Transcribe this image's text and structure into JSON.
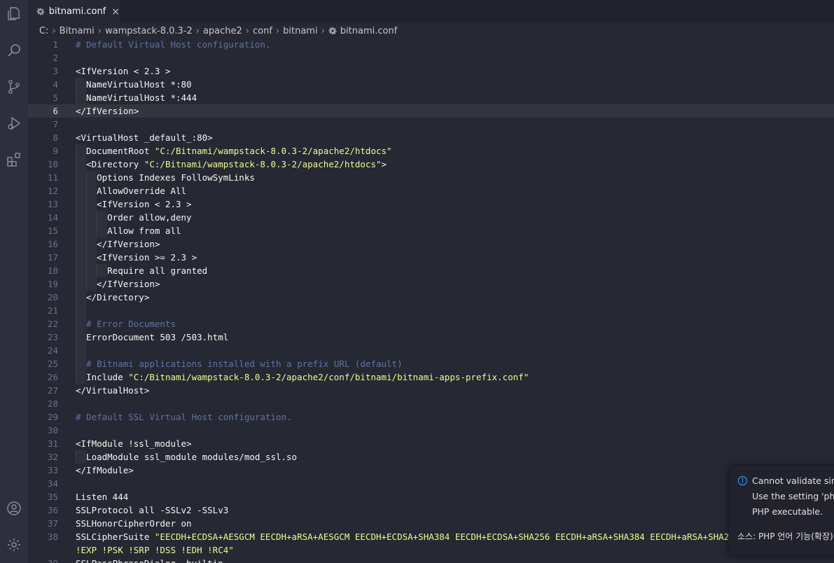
{
  "activity_bar": {
    "items": [
      {
        "icon": "explorer-icon"
      },
      {
        "icon": "search-icon"
      },
      {
        "icon": "source-control-icon"
      },
      {
        "icon": "run-debug-icon"
      },
      {
        "icon": "extensions-icon"
      }
    ],
    "bottom": [
      {
        "icon": "account-icon"
      },
      {
        "icon": "manage-gear-icon"
      }
    ]
  },
  "tab": {
    "label": "bitnami.conf",
    "close": "×",
    "icon": "settings-file-icon"
  },
  "breadcrumb": [
    "C:",
    "Bitnami",
    "wampstack-8.0.3-2",
    "apache2",
    "conf",
    "bitnami",
    "bitnami.conf"
  ],
  "editor": {
    "current_line": 6,
    "lines": [
      [
        [
          "c",
          "# Default Virtual Host configuration."
        ]
      ],
      [],
      [
        [
          "t",
          "<IfVersion < 2.3 >"
        ]
      ],
      [
        [
          "t",
          "  NameVirtualHost *:80"
        ]
      ],
      [
        [
          "t",
          "  NameVirtualHost *:444"
        ]
      ],
      [
        [
          "t",
          "</IfVersion>"
        ]
      ],
      [],
      [
        [
          "t",
          "<VirtualHost _default_:80>"
        ]
      ],
      [
        [
          "t",
          "  DocumentRoot "
        ],
        [
          "s",
          "\"C:/Bitnami/wampstack-8.0.3-2/apache2/htdocs\""
        ]
      ],
      [
        [
          "t",
          "  <Directory "
        ],
        [
          "s",
          "\"C:/Bitnami/wampstack-8.0.3-2/apache2/htdocs\""
        ],
        [
          "t",
          ">"
        ]
      ],
      [
        [
          "t",
          "    Options Indexes FollowSymLinks"
        ]
      ],
      [
        [
          "t",
          "    AllowOverride All"
        ]
      ],
      [
        [
          "t",
          "    <IfVersion < 2.3 >"
        ]
      ],
      [
        [
          "t",
          "      Order allow,deny"
        ]
      ],
      [
        [
          "t",
          "      Allow from all"
        ]
      ],
      [
        [
          "t",
          "    </IfVersion>"
        ]
      ],
      [
        [
          "t",
          "    <IfVersion >= 2.3 >"
        ]
      ],
      [
        [
          "t",
          "      Require all granted"
        ]
      ],
      [
        [
          "t",
          "    </IfVersion>"
        ]
      ],
      [
        [
          "t",
          "  </Directory>"
        ]
      ],
      [],
      [
        [
          "t",
          "  "
        ],
        [
          "c",
          "# Error Documents"
        ]
      ],
      [
        [
          "t",
          "  ErrorDocument 503 /503.html"
        ]
      ],
      [],
      [
        [
          "t",
          "  "
        ],
        [
          "c",
          "# Bitnami applications installed with a prefix URL (default)"
        ]
      ],
      [
        [
          "t",
          "  Include "
        ],
        [
          "s",
          "\"C:/Bitnami/wampstack-8.0.3-2/apache2/conf/bitnami/bitnami-apps-prefix.conf\""
        ]
      ],
      [
        [
          "t",
          "</VirtualHost>"
        ]
      ],
      [],
      [
        [
          "c",
          "# Default SSL Virtual Host configuration."
        ]
      ],
      [],
      [
        [
          "t",
          "<IfModule !ssl_module>"
        ]
      ],
      [
        [
          "t",
          "  LoadModule ssl_module modules/mod_ssl.so"
        ]
      ],
      [
        [
          "t",
          "</IfModule>"
        ]
      ],
      [],
      [
        [
          "t",
          "Listen 444"
        ]
      ],
      [
        [
          "t",
          "SSLProtocol all -SSLv2 -SSLv3"
        ]
      ],
      [
        [
          "t",
          "SSLHonorCipherOrder on"
        ]
      ],
      [
        [
          "t",
          "SSLCipherSuite "
        ],
        [
          "s",
          "\"EECDH+ECDSA+AESGCM EECDH+aRSA+AESGCM EECDH+ECDSA+SHA384 EECDH+ECDSA+SHA256 EECDH+aRSA+SHA384 EECDH+aRSA+SHA256 EECDH"
        ]
      ],
      [
        [
          "s",
          "!EXP !PSK !SRP !DSS !EDH !RC4\""
        ]
      ],
      [
        [
          "t",
          "SSLPassPhraseDialog  builtin"
        ]
      ]
    ],
    "line_numbers": [
      "1",
      "2",
      "3",
      "4",
      "5",
      "6",
      "7",
      "8",
      "9",
      "10",
      "11",
      "12",
      "13",
      "14",
      "15",
      "16",
      "17",
      "18",
      "19",
      "20",
      "21",
      "22",
      "23",
      "24",
      "25",
      "26",
      "27",
      "28",
      "29",
      "30",
      "31",
      "32",
      "33",
      "34",
      "35",
      "36",
      "37",
      "38",
      "",
      "39"
    ]
  },
  "notification": {
    "line1": "Cannot validate since",
    "line2": "Use the setting 'php.",
    "line3": "PHP executable.",
    "source": "소스: PHP 언어 기능(확장)"
  },
  "colors": {
    "comment": "#6272a4",
    "string": "#f1fa8c",
    "text": "#f8f8f2",
    "background": "#262834"
  }
}
